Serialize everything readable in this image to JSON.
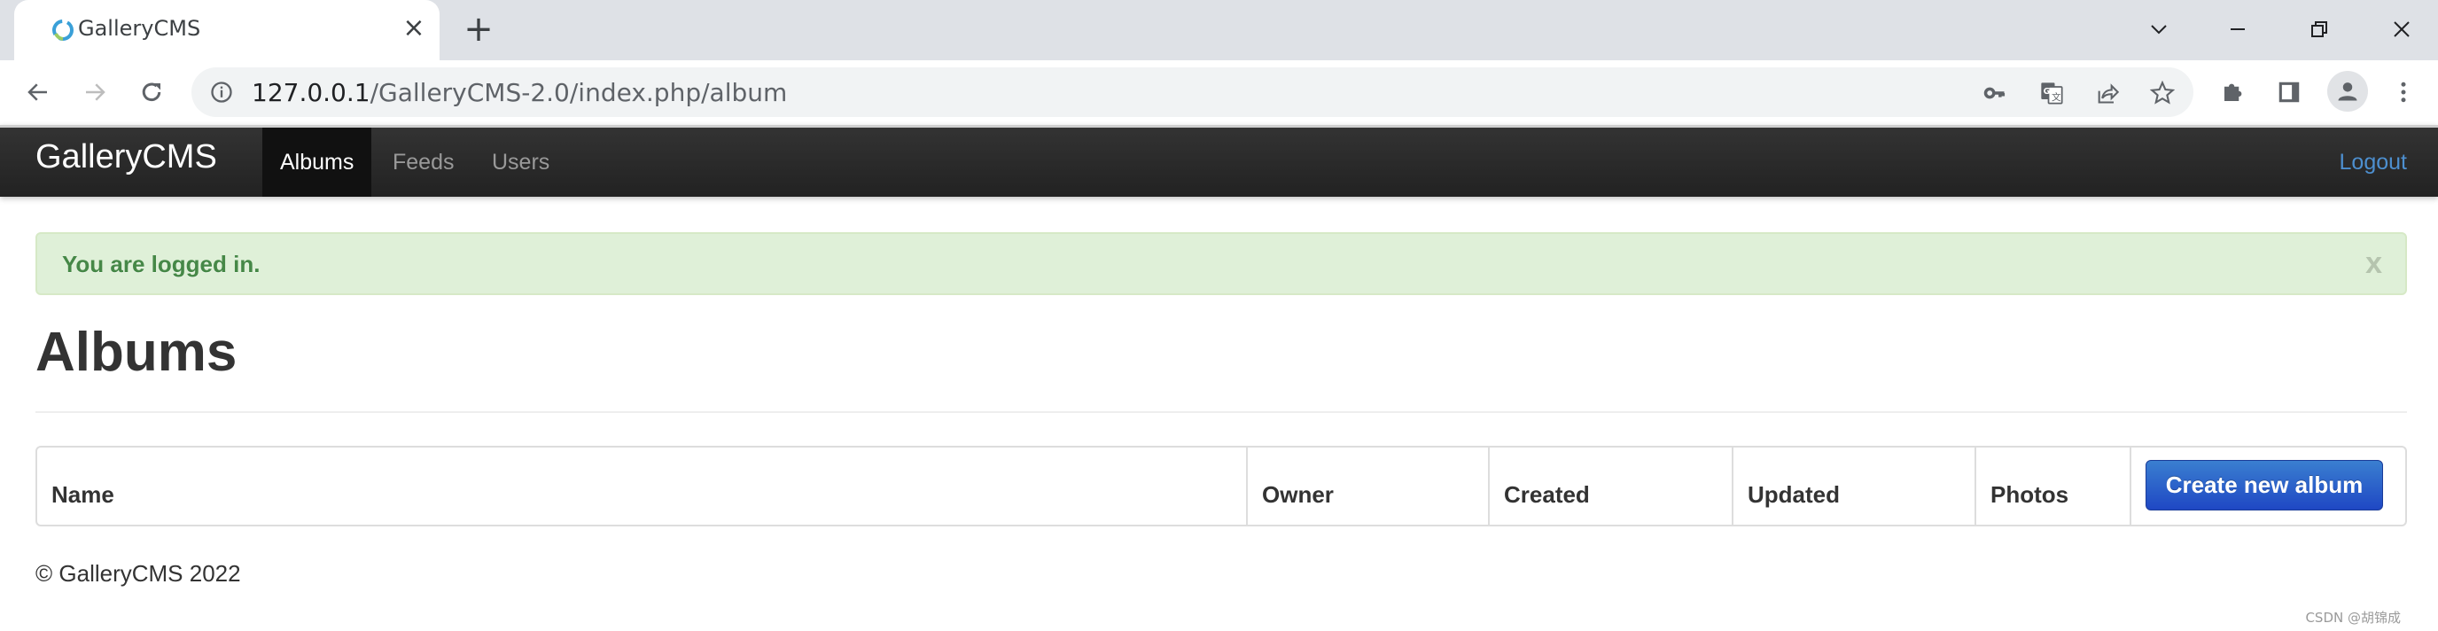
{
  "browser": {
    "tab": {
      "title": "GalleryCMS",
      "favicon": "gallerycms-ring-icon",
      "close_label": "×"
    },
    "new_tab_label": "+",
    "url": {
      "host": "127.0.0.1",
      "path": "/GalleryCMS-2.0/index.php/album"
    },
    "toolbar_icons": [
      "back-arrow-icon",
      "forward-arrow-icon",
      "reload-icon",
      "site-info-icon",
      "password-key-icon",
      "translate-icon",
      "share-icon",
      "bookmark-star-icon",
      "extensions-puzzle-icon",
      "side-panel-icon",
      "profile-avatar-icon",
      "more-menu-icon"
    ],
    "window_controls": [
      "tab-search-chevron-icon",
      "minimize-icon",
      "restore-icon",
      "close-window-icon"
    ]
  },
  "navbar": {
    "brand": "GalleryCMS",
    "items": [
      {
        "label": "Albums",
        "active": true
      },
      {
        "label": "Feeds",
        "active": false
      },
      {
        "label": "Users",
        "active": false
      }
    ],
    "logout": "Logout"
  },
  "alert": {
    "message": "You are logged in.",
    "close_label": "x"
  },
  "page": {
    "title": "Albums"
  },
  "table": {
    "columns": [
      "Name",
      "Owner",
      "Created",
      "Updated",
      "Photos"
    ],
    "rows": [],
    "create_button": "Create new album"
  },
  "footer": {
    "text": "© GalleryCMS 2022"
  },
  "watermark": "CSDN @胡锦成",
  "colors": {
    "navbar_bg": "#222222",
    "link": "#4d8fcf",
    "alert_bg": "#dff0d8",
    "alert_text": "#468847",
    "primary_button": "#1f48c4"
  }
}
